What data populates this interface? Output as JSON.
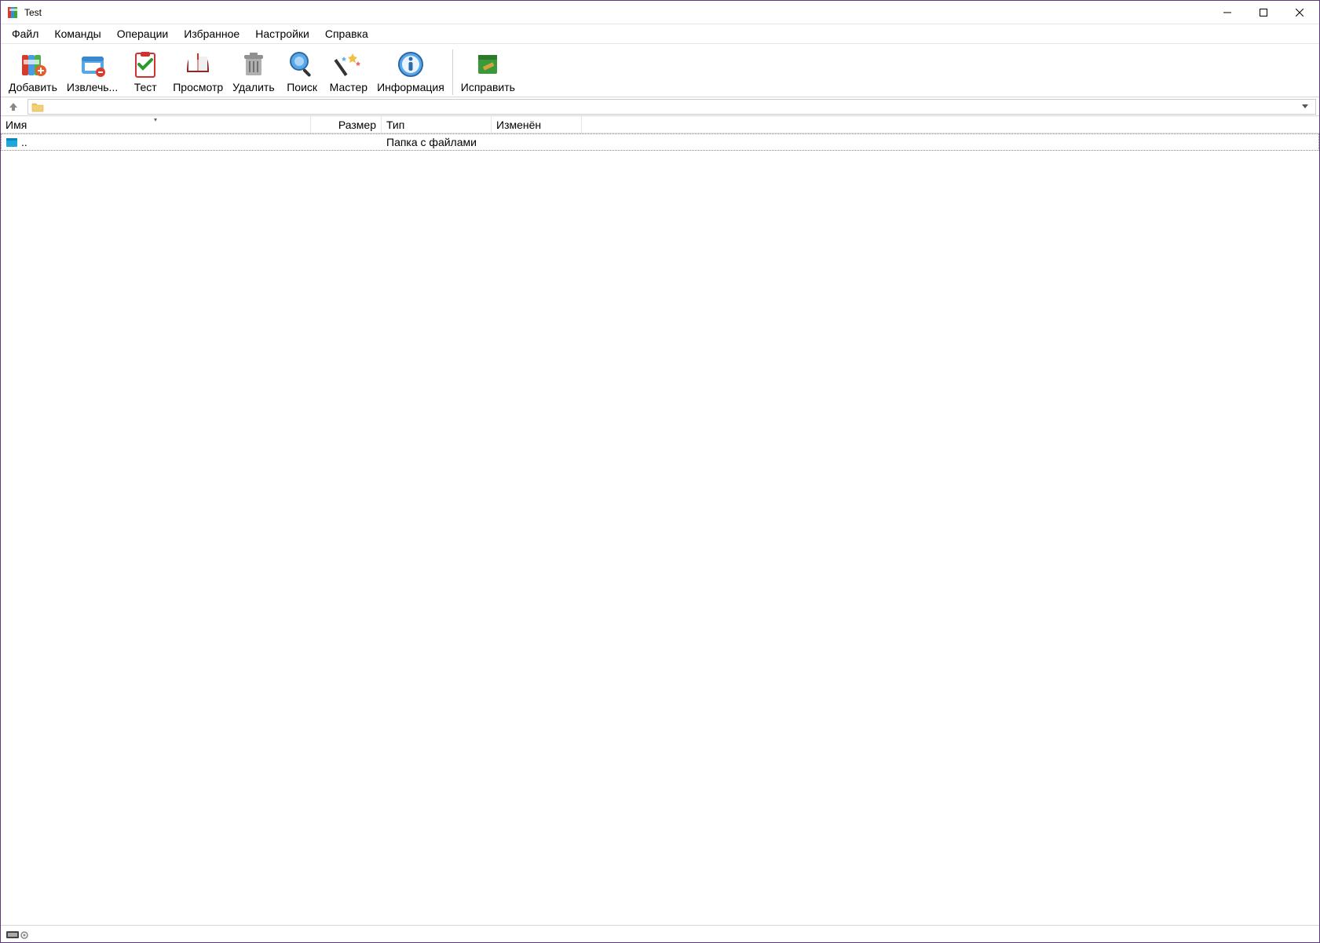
{
  "window": {
    "title": "Test"
  },
  "menu": {
    "items": [
      "Файл",
      "Команды",
      "Операции",
      "Избранное",
      "Настройки",
      "Справка"
    ]
  },
  "toolbar": {
    "buttons": [
      {
        "id": "add",
        "label": "Добавить"
      },
      {
        "id": "extract",
        "label": "Извлечь..."
      },
      {
        "id": "test",
        "label": "Тест"
      },
      {
        "id": "view",
        "label": "Просмотр"
      },
      {
        "id": "delete",
        "label": "Удалить"
      },
      {
        "id": "find",
        "label": "Поиск"
      },
      {
        "id": "wizard",
        "label": "Мастер"
      },
      {
        "id": "info",
        "label": "Информация"
      },
      {
        "id": "repair",
        "label": "Исправить"
      }
    ]
  },
  "address": {
    "path": ""
  },
  "columns": {
    "name": "Имя",
    "size": "Размер",
    "type": "Тип",
    "modified": "Изменён"
  },
  "rows": [
    {
      "name": "..",
      "size": "",
      "type": "Папка с файлами",
      "modified": "",
      "icon": "up-dir"
    }
  ]
}
